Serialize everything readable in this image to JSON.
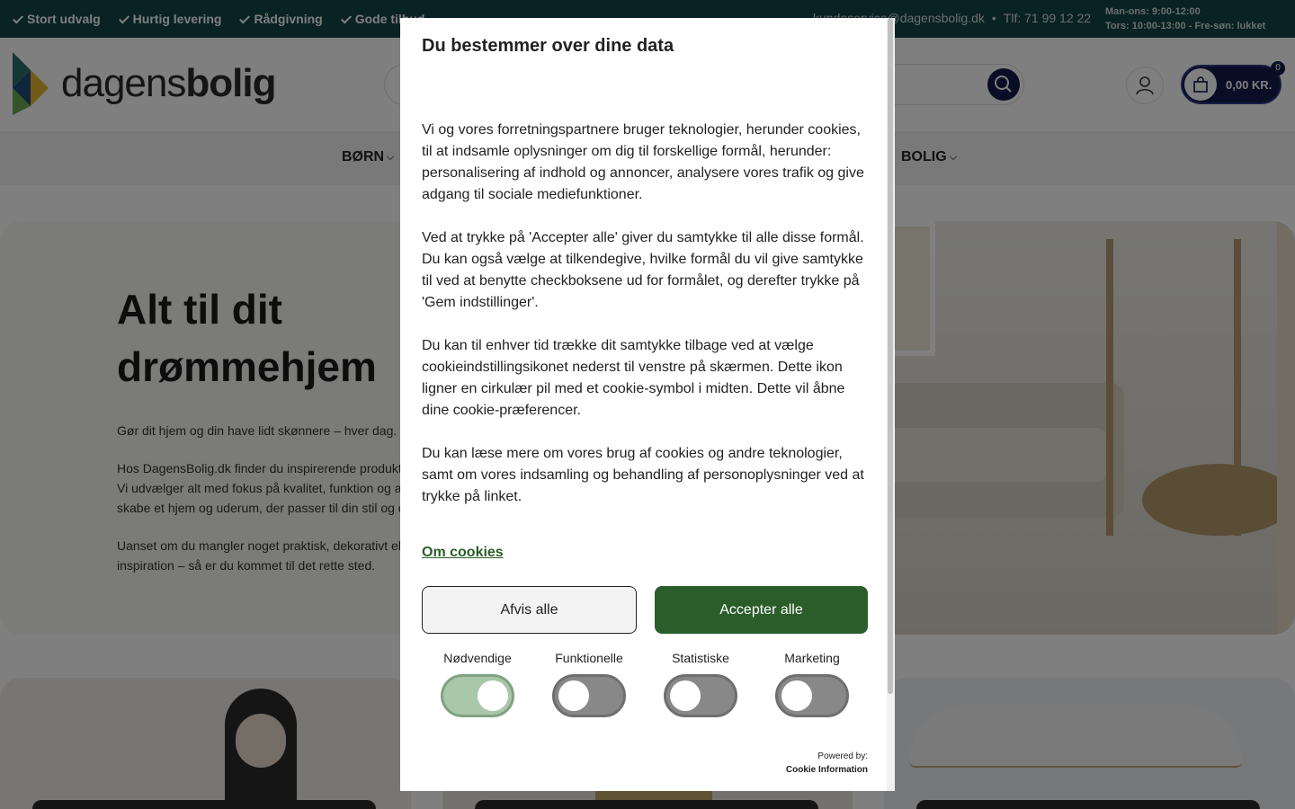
{
  "topbar": {
    "usps": [
      "Stort udvalg",
      "Hurtig levering",
      "Rådgivning",
      "Gode tilbud"
    ],
    "email": "kundeservice@dagensbolig.dk",
    "separator": "•",
    "phone": "Tlf: 71 99 12 22",
    "hours": [
      "Man-ons: 9:00-12:00",
      "Tors: 10:00-13:00 - Fre-søn: lukket"
    ]
  },
  "header": {
    "logo": {
      "part1": "dagens",
      "part2": "bolig"
    },
    "cart": {
      "total": "0,00 KR.",
      "count": "0"
    }
  },
  "nav": {
    "items": [
      "BØRN",
      "BOLIG"
    ]
  },
  "hero": {
    "title": "Alt til dit drømmehjem",
    "paragraphs": [
      "Gør dit hjem og din have lidt skønnere – hver dag.",
      "Hos DagensBolig.dk finder du inspirerende produkt\nVi udvælger alt med fokus på kvalitet, funktion og a\nskabe et hjem og uderum, der passer til din stil og d",
      "Uanset om du mangler noget praktisk, dekorativt el\ninspiration – så er du kommet til det rette sted."
    ]
  },
  "modal": {
    "title": "Du bestemmer over dine data",
    "paragraphs": [
      "Vi og vores forretningspartnere bruger teknologier, herunder cookies, til at indsamle oplysninger om dig til forskellige formål, herunder: personalisering af indhold og annoncer, analysere vores trafik og give adgang til sociale mediefunktioner.",
      "Ved at trykke på 'Accepter alle' giver du samtykke til alle disse formål. Du kan også vælge at tilkendegive, hvilke formål du vil give samtykke til ved at benytte checkboksene ud for formålet, og derefter trykke på 'Gem indstillinger'.",
      "Du kan til enhver tid trække dit samtykke tilbage ved at vælge cookieindstillingsikonet nederst til venstre på skærmen. Dette ikon ligner en cirkulær pil med et cookie-symbol i midten. Dette vil åbne dine cookie-præferencer.",
      "Du kan læse mere om vores brug af cookies og andre teknologier, samt om vores indsamling og behandling af personoplysninger ved at trykke på linket."
    ],
    "link": "Om cookies",
    "reject_label": "Afvis alle",
    "accept_label": "Accepter alle",
    "consents": [
      {
        "label": "Nødvendige",
        "on": true
      },
      {
        "label": "Funktionelle",
        "on": false
      },
      {
        "label": "Statistiske",
        "on": false
      },
      {
        "label": "Marketing",
        "on": false
      }
    ],
    "powered_by": "Powered by:",
    "provider": "Cookie Information"
  },
  "colors": {
    "topbar": "#134446",
    "brand_navy": "#131a4a",
    "accept_green": "#2a5d2a",
    "toggle_on": "#a9c7a9",
    "toggle_off": "#888888"
  }
}
